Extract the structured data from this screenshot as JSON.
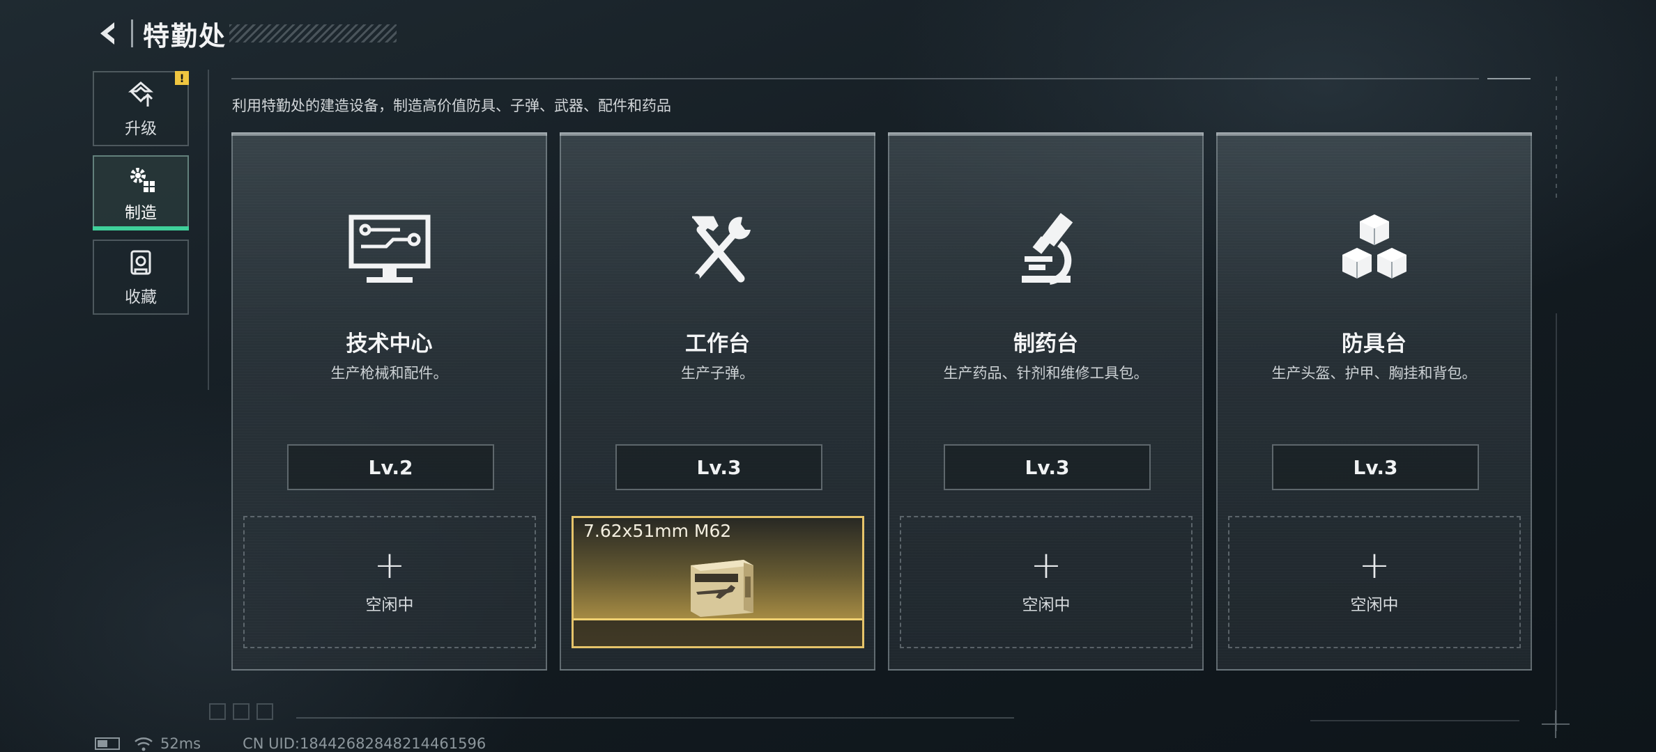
{
  "header": {
    "title": "特勤处"
  },
  "nav": {
    "items": [
      {
        "label": "升级",
        "icon": "upgrade-icon",
        "badge": "!"
      },
      {
        "label": "制造",
        "icon": "craft-gear-icon"
      },
      {
        "label": "收藏",
        "icon": "collection-icon"
      }
    ],
    "active": "制造"
  },
  "description": "利用特勤处的建造设备，制造高价值防具、子弹、武器、配件和药品",
  "stations": [
    {
      "name": "技术中心",
      "subtitle": "生产枪械和配件。",
      "level": "Lv.2",
      "icon": "computer-icon",
      "slot": {
        "status": "空闲中"
      }
    },
    {
      "name": "工作台",
      "subtitle": "生产子弹。",
      "level": "Lv.3",
      "icon": "hammer-wrench-icon",
      "slot": {
        "item": "7.62x51mm M62"
      }
    },
    {
      "name": "制药台",
      "subtitle": "生产药品、针剂和维修工具包。",
      "level": "Lv.3",
      "icon": "microscope-icon",
      "slot": {
        "status": "空闲中"
      }
    },
    {
      "name": "防具台",
      "subtitle": "生产头盔、护甲、胸挂和背包。",
      "level": "Lv.3",
      "icon": "cubes-icon",
      "slot": {
        "status": "空闲中"
      }
    }
  ],
  "status_bar": {
    "ping": "52ms",
    "uid": "CN UID:18442682848214461596"
  },
  "colors": {
    "accent_green": "#3fd09a",
    "gold": "#e6c46a",
    "badge_yellow": "#f0c640"
  }
}
